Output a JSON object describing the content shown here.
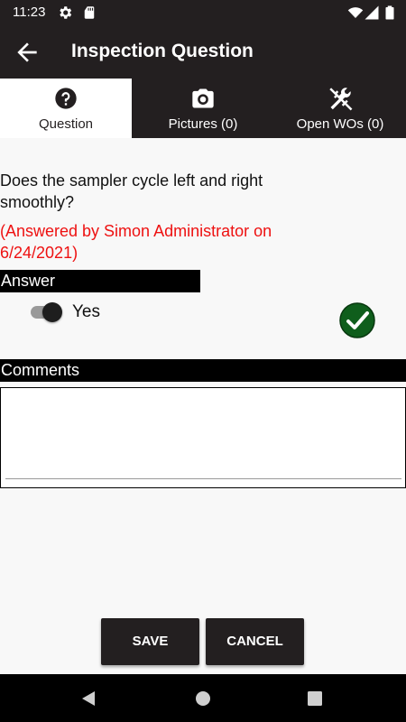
{
  "status_bar": {
    "time": "11:23",
    "left_icons": [
      "gear-icon",
      "sd-card-icon"
    ],
    "right_icons": [
      "wifi-icon",
      "signal-icon",
      "battery-icon"
    ]
  },
  "app_bar": {
    "back_icon": "arrow-left-icon",
    "title": "Inspection Question"
  },
  "tabs": [
    {
      "label": "Question",
      "icon": "question-circle-icon",
      "active": true
    },
    {
      "label": "Pictures (0)",
      "icon": "camera-icon",
      "active": false
    },
    {
      "label": "Open WOs (0)",
      "icon": "tools-icon",
      "active": false
    }
  ],
  "question": {
    "text": "Does the sampler cycle left and right smoothly?",
    "answered_by": "(Answered by Simon Administrator on 6/24/2021)"
  },
  "answer": {
    "header": "Answer",
    "toggle_label": "Yes",
    "toggle_on": true,
    "status_icon": "check-circle-icon"
  },
  "comments": {
    "header": "Comments",
    "value": ""
  },
  "buttons": {
    "save_label": "SAVE",
    "cancel_label": "CANCEL"
  },
  "nav_bar": {
    "icons": [
      "back-triangle-icon",
      "home-circle-icon",
      "recents-square-icon"
    ]
  },
  "colors": {
    "bar": "#231f20",
    "accent_red": "#ee1111",
    "check_green": "#0f5e1c"
  }
}
